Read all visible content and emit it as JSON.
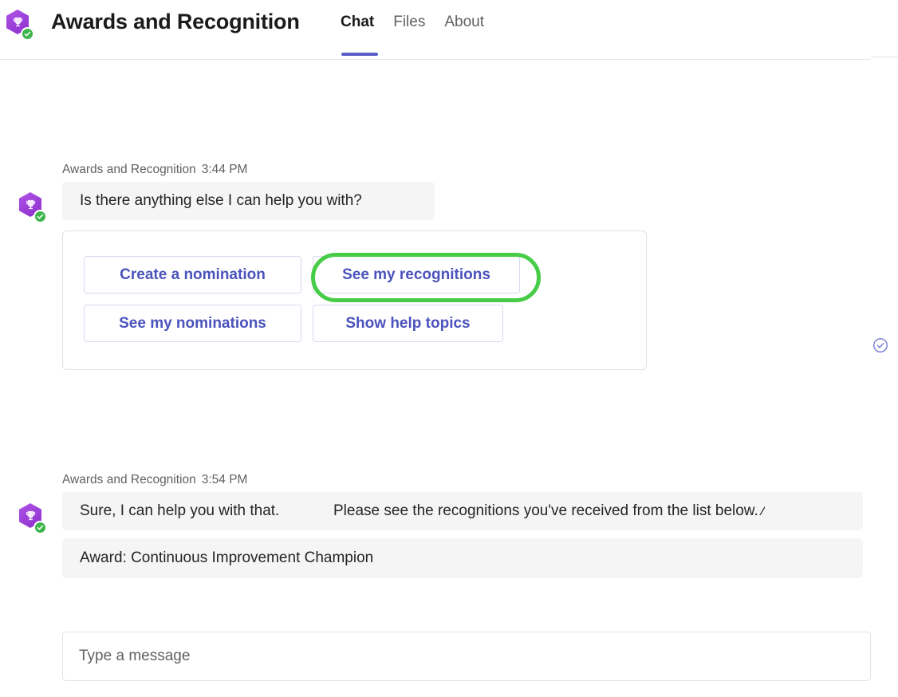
{
  "header": {
    "app_title": "Awards and Recognition",
    "avatar": {
      "icon": "trophy-icon",
      "glyph": " ",
      "presence": "available-check-icon",
      "hex_color": "#9b3fd8",
      "presence_color": "#3db54a"
    },
    "tabs": [
      {
        "label": "Chat",
        "active": true
      },
      {
        "label": "Files",
        "active": false
      },
      {
        "label": "About",
        "active": false
      }
    ],
    "active_tab_underline_color": "#5b5fc7"
  },
  "conversation": {
    "groups": [
      {
        "author": "Awards and Recognition",
        "time": "3:44 PM",
        "message": "Is there anything else I can help you with?",
        "card": {
          "buttons": [
            {
              "label": "Create a nomination",
              "highlighted": false
            },
            {
              "label": "See my recognitions",
              "highlighted": true
            },
            {
              "label": "See my nominations",
              "highlighted": false
            },
            {
              "label": "Show help topics",
              "highlighted": false
            }
          ]
        },
        "read_receipt": "seen-check-circle-icon"
      },
      {
        "author": "Awards and Recognition",
        "time": "3:54 PM",
        "message_front": "Sure, I can help you with that.",
        "message_back": "Please see the recognitions you've received from the list below. ⁄",
        "message_award": "Award: Continuous Improvement Champion"
      }
    ]
  },
  "composer": {
    "placeholder": "Type a message",
    "value": ""
  },
  "colors": {
    "accent_purple": "#5b5fc7",
    "button_text": "#4b53bc",
    "bubble_bg": "#f5f5f5",
    "highlight_ring": "#47cc47"
  }
}
